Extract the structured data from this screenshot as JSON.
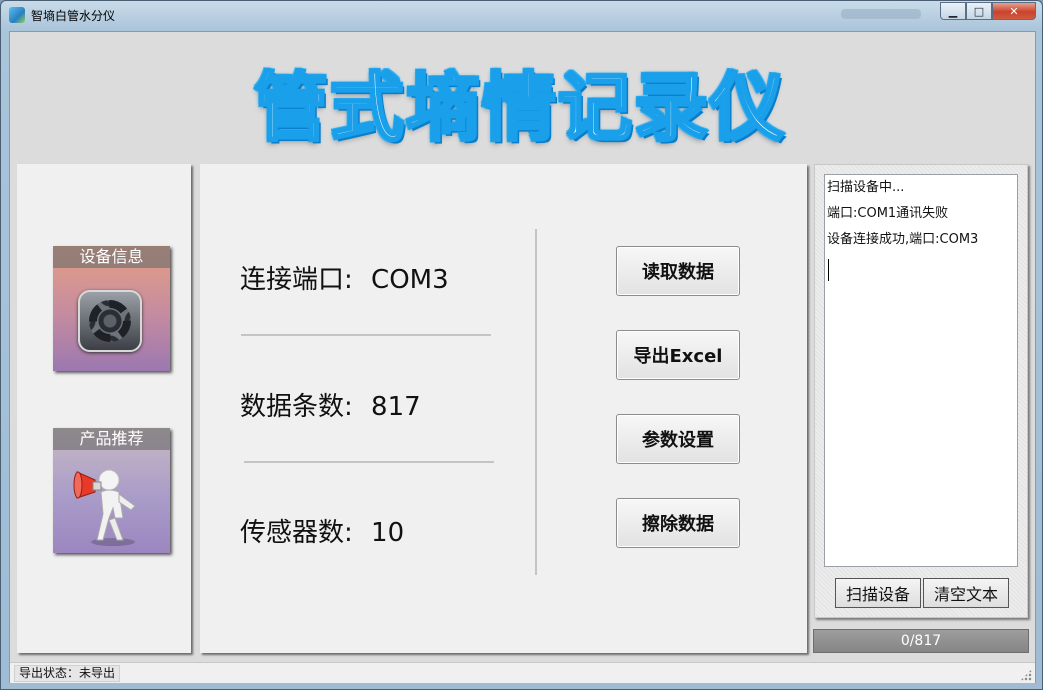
{
  "window": {
    "title": "智墒白管水分仪",
    "buttons": {
      "minimize": "▁",
      "maximize": "□",
      "close": "✕"
    }
  },
  "banner": {
    "title": "管式墒情记录仪"
  },
  "left_panel": {
    "tiles": [
      {
        "label": "设备信息",
        "icon": "gear-icon"
      },
      {
        "label": "产品推荐",
        "icon": "megaphone-person-icon"
      }
    ]
  },
  "center_panel": {
    "rows": [
      {
        "label": "连接端口",
        "sep": ":",
        "value": "COM3"
      },
      {
        "label": "数据条数",
        "sep": ":",
        "value": "817"
      },
      {
        "label": "传感器数",
        "sep": ":",
        "value": "10"
      }
    ],
    "buttons": {
      "read": "读取数据",
      "export": "导出Excel",
      "settings": "参数设置",
      "erase": "擦除数据"
    }
  },
  "right_panel": {
    "log_lines": [
      "扫描设备中...",
      "端口:COM1通讯失败",
      "设备连接成功,端口:COM3"
    ],
    "scan_button": "扫描设备",
    "clear_button": "清空文本"
  },
  "progress": {
    "text": "0/817",
    "fraction": 0
  },
  "status_bar": {
    "text": "导出状态：未导出"
  },
  "colors": {
    "banner_stroke": "#1aa0ea",
    "progress_bg": "#8f8f8f"
  }
}
